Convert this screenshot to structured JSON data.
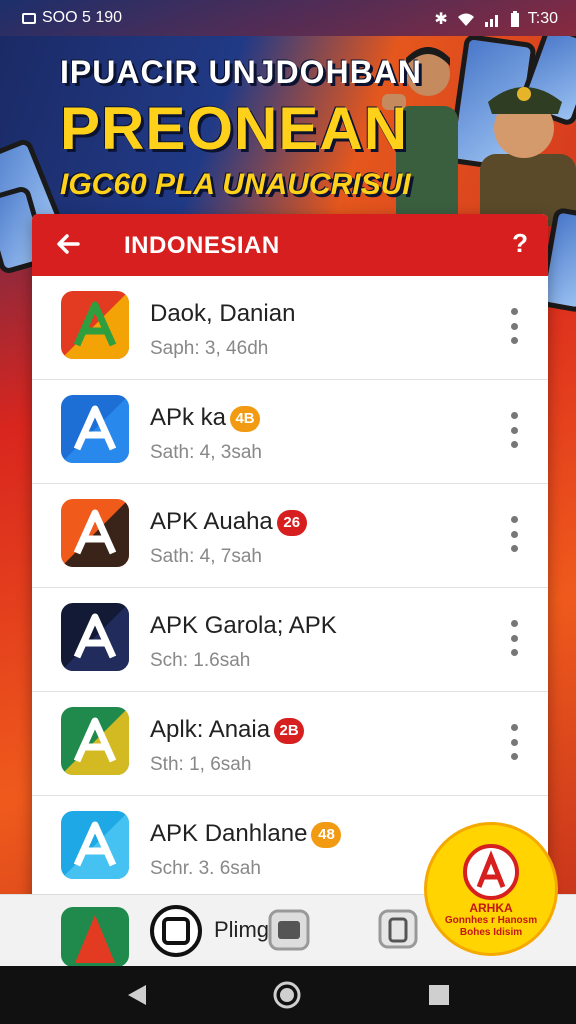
{
  "status_bar": {
    "left_text": "SOO 5 190",
    "time": "T:30"
  },
  "banner": {
    "line1": "IPUACIR UNJDOHBAN",
    "line2": "PREONEAN",
    "line3": "IGC60 PLA UNAUCRISUI"
  },
  "app_bar": {
    "title": "INDONESIAN",
    "help_icon": "help-icon",
    "back_icon": "back-arrow-icon"
  },
  "apps": [
    {
      "name": "Daok, Danian",
      "badge": "",
      "sub": "Saph: 3, 46dh",
      "colors": [
        "#e23b22",
        "#f6b600",
        "#2f9e3f"
      ]
    },
    {
      "name": "APk ka",
      "badge": "4B",
      "badge_color": "#f29a12",
      "sub": "Sath: 4, 3sah",
      "colors": [
        "#1d6fd6",
        "#2c8df0",
        "#ffffff"
      ]
    },
    {
      "name": "APK Auaha",
      "badge": "26",
      "badge_color": "#d81f1f",
      "sub": "Sath: 4, 7sah",
      "colors": [
        "#f05a1a",
        "#1a1a1a",
        "#ffffff"
      ]
    },
    {
      "name": "APK Garola; APK",
      "badge": "",
      "sub": "Sch: 1.6sah",
      "colors": [
        "#131a36",
        "#243064",
        "#ffffff"
      ]
    },
    {
      "name": "Aplk: Anaia",
      "badge": "2B",
      "badge_color": "#d81f1f",
      "sub": "Sth: 1, 6sah",
      "colors": [
        "#1f8a4c",
        "#f4c21b",
        "#ffffff"
      ]
    },
    {
      "name": "APK Danhlane",
      "badge": "48",
      "badge_color": "#f29a12",
      "sub": "Schr. 3. 6sah",
      "colors": [
        "#1ea9e6",
        "#4cc7f2",
        "#ffffff"
      ]
    }
  ],
  "bottom_row": {
    "label": "Plimg"
  },
  "promo": {
    "title": "ARHKA",
    "sub1": "Gonnhes r Hanosm",
    "sub2": "Bohes Idisim"
  }
}
